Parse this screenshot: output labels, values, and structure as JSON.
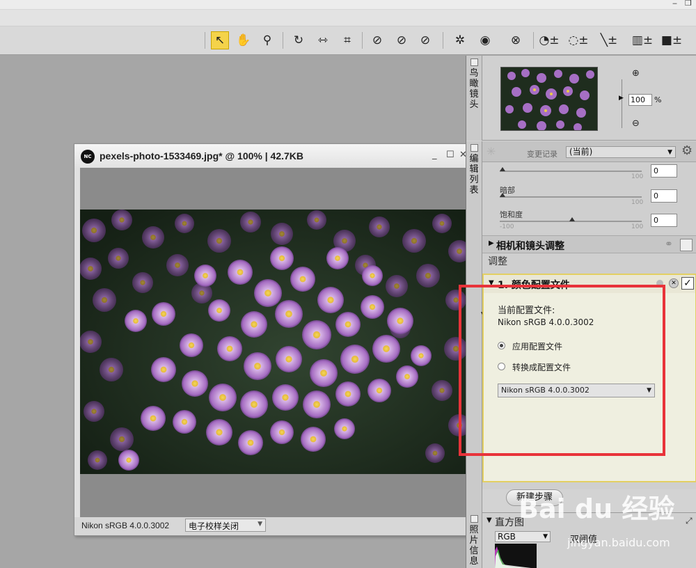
{
  "window": {
    "title": "pexels-photo-1533469.jpg* @ 100% | 42.7KB",
    "app_badge": "NC",
    "minimize_icon": "minimize-icon",
    "maximize_icon": "maximize-icon",
    "close_icon": "close-icon",
    "status_profile": "Nikon sRGB 4.0.0.3002",
    "softproof_value": "电子校样关闭"
  },
  "toolbar": {
    "tools": [
      "pointer-icon",
      "hand-icon",
      "zoom-icon",
      "rotate-icon",
      "straighten-icon",
      "crop-icon",
      "white-point-picker-icon",
      "gray-point-picker-icon",
      "black-point-picker-icon",
      "red-eye-icon",
      "eye-icon",
      "retouch-brush-icon",
      "control-point-icon",
      "selection-control-point-icon",
      "brush-icon",
      "gradient-icon",
      "fill-icon"
    ]
  },
  "birdseye": {
    "tab_label": "鸟瞰镜头",
    "zoom_value": "100",
    "zoom_unit": "%"
  },
  "edit_list": {
    "tab_label": "编辑列表",
    "history_label": "变更记录",
    "history_value": "(当前)",
    "sliders": [
      {
        "label": "",
        "min": "",
        "max": "100",
        "value": "0",
        "fraction": 0.0
      },
      {
        "label": "暗部",
        "min": "",
        "max": "100",
        "value": "0",
        "fraction": 0.0
      },
      {
        "label": "饱和度",
        "min": "-100",
        "max": "100",
        "value": "0",
        "fraction": 0.5
      }
    ],
    "camera_lens": "相机和镜头调整",
    "adjust": "调整",
    "color_profile_step": "1. 颜色配置文件",
    "current_profile_label": "当前配置文件:",
    "current_profile_value": "Nikon sRGB 4.0.0.3002",
    "apply_profile": "应用配置文件",
    "convert_profile": "转换成配置文件",
    "profile_select": "Nikon sRGB 4.0.0.3002",
    "new_step": "新建步骤"
  },
  "histogram": {
    "title": "直方图",
    "channel": "RGB",
    "threshold_label": "双阈值",
    "tab_label": "照片信息"
  },
  "watermark": {
    "brand": "Bai du 经验",
    "url": "jingyan.baidu.com"
  },
  "colors": {
    "annotation": "#e8333a",
    "active_tool": "#f4d34a",
    "step_border": "#e3cf62"
  }
}
